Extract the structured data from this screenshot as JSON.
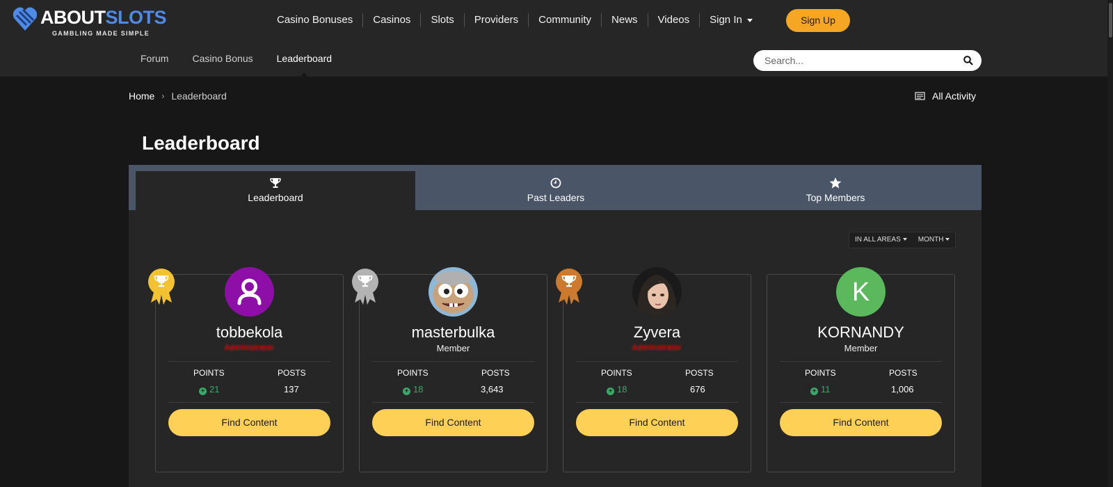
{
  "logo": {
    "word1": "ABOUT",
    "word2": "SLOTS",
    "tagline": "GAMBLING MADE SIMPLE"
  },
  "colors": {
    "accent_blue": "#4f8ae6",
    "signup": "#f5a623",
    "find_btn": "#ffd056",
    "tabs_bg": "#4a5568",
    "points_green": "#3aa86b"
  },
  "nav": {
    "items": [
      "Casino Bonuses",
      "Casinos",
      "Slots",
      "Providers",
      "Community",
      "News",
      "Videos"
    ],
    "signin": "Sign In",
    "signup": "Sign Up"
  },
  "subnav": {
    "items": [
      "Forum",
      "Casino Bonus",
      "Leaderboard"
    ],
    "active": "Leaderboard"
  },
  "search": {
    "placeholder": "Search...",
    "icon": "search-icon"
  },
  "breadcrumb": {
    "home": "Home",
    "current": "Leaderboard"
  },
  "all_activity": "All Activity",
  "page_title": "Leaderboard",
  "tabs": [
    {
      "label": "Leaderboard",
      "icon": "trophy-icon",
      "active": true
    },
    {
      "label": "Past Leaders",
      "icon": "clock-icon",
      "active": false
    },
    {
      "label": "Top Members",
      "icon": "star-icon",
      "active": false
    }
  ],
  "filters": {
    "area": "IN ALL AREAS",
    "period": "MONTH"
  },
  "stat_labels": {
    "points": "POINTS",
    "posts": "POSTS"
  },
  "find_label": "Find Content",
  "leaders": [
    {
      "rank": 1,
      "name": "tobbekola",
      "role": "Administrator",
      "points": "21",
      "posts": "137"
    },
    {
      "rank": 2,
      "name": "masterbulka",
      "role": "Member",
      "points": "18",
      "posts": "3,643"
    },
    {
      "rank": 3,
      "name": "Zyvera",
      "role": "Administrator",
      "points": "18",
      "posts": "676"
    },
    {
      "rank": 4,
      "name": "KORNANDY",
      "role": "Member",
      "points": "11",
      "posts": "1,006",
      "avatar_letter": "K"
    }
  ]
}
